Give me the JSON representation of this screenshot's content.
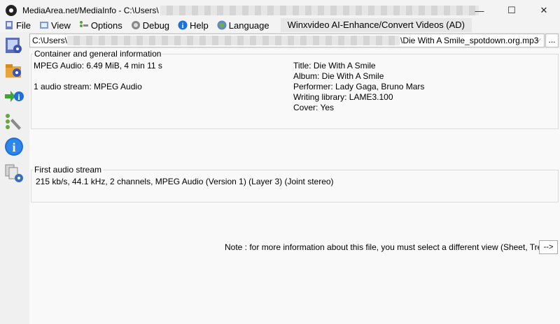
{
  "window": {
    "title_prefix": "MediaArea.net/MediaInfo - C:\\Users\\",
    "controls": {
      "minimize": "—",
      "maximize": "☐",
      "close": "✕"
    }
  },
  "menu": {
    "items": [
      {
        "label": "File",
        "icon": "file-icon"
      },
      {
        "label": "View",
        "icon": "view-icon"
      },
      {
        "label": "Options",
        "icon": "options-icon"
      },
      {
        "label": "Debug",
        "icon": "debug-icon"
      },
      {
        "label": "Help",
        "icon": "help-icon"
      },
      {
        "label": "Language",
        "icon": "language-icon"
      }
    ],
    "ad": "Winxvideo AI-Enhance/Convert Videos (AD)"
  },
  "path": {
    "prefix": "C:\\Users\\",
    "file": "\\Die With A Smile_spotdown.org.mp3",
    "dropdown": "⌵",
    "browse": "..."
  },
  "general": {
    "legend": "Container and general information",
    "left": [
      "MPEG Audio: 6.49 MiB, 4 min 11 s",
      "1 audio stream: MPEG Audio"
    ],
    "right": [
      "Title: Die With A Smile",
      "Album: Die With A Smile",
      "Performer: Lady Gaga, Bruno Mars",
      "Writing library: LAME3.100",
      "Cover: Yes"
    ]
  },
  "audio": {
    "legend": "First audio stream",
    "line": "215 kb/s, 44.1 kHz, 2 channels, MPEG Audio (Version 1) (Layer 3) (Joint stereo)"
  },
  "note": {
    "text": "Note : for more information about this file, you must select a different view (Sheet, Tree...)",
    "button": "-->"
  }
}
